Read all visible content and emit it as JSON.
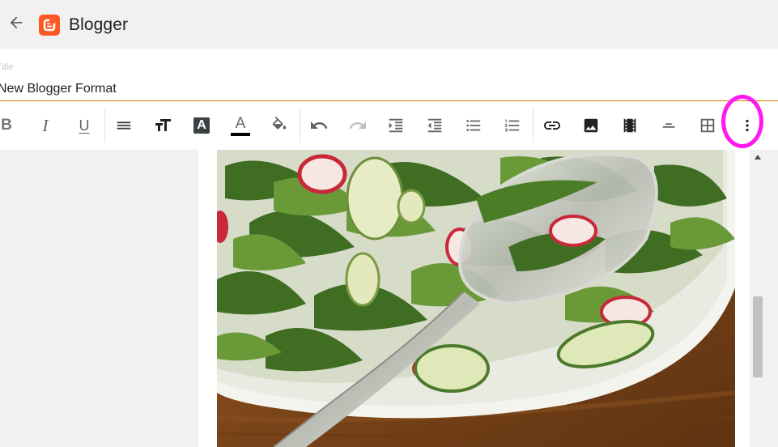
{
  "header": {
    "app_name": "Blogger",
    "back_icon": "arrow-back-icon",
    "logo_icon": "blogger-logo-icon",
    "logo_color": "#ff5722"
  },
  "post": {
    "title_label": "Title",
    "title_value": "New Blogger Format"
  },
  "toolbar": {
    "buttons": [
      {
        "name": "bold",
        "label": "B",
        "icon": "bold-icon"
      },
      {
        "name": "italic",
        "label": "I",
        "icon": "italic-icon"
      },
      {
        "name": "underline",
        "label": "U",
        "icon": "underline-icon"
      },
      {
        "name": "paragraph",
        "icon": "paragraph-format-icon"
      },
      {
        "name": "font-size",
        "label": "TT",
        "icon": "font-size-icon"
      },
      {
        "name": "text-background",
        "label": "A",
        "icon": "text-background-icon"
      },
      {
        "name": "text-color",
        "label": "A",
        "icon": "text-color-icon"
      },
      {
        "name": "fill-color",
        "icon": "paint-bucket-icon"
      },
      {
        "name": "undo",
        "icon": "undo-icon"
      },
      {
        "name": "redo",
        "icon": "redo-icon"
      },
      {
        "name": "indent",
        "icon": "indent-icon"
      },
      {
        "name": "outdent",
        "icon": "outdent-icon"
      },
      {
        "name": "bulleted-list",
        "icon": "bulleted-list-icon"
      },
      {
        "name": "numbered-list",
        "icon": "numbered-list-icon"
      },
      {
        "name": "link",
        "icon": "link-icon"
      },
      {
        "name": "image",
        "icon": "image-icon"
      },
      {
        "name": "video",
        "icon": "video-icon"
      },
      {
        "name": "align",
        "icon": "align-icon"
      },
      {
        "name": "table",
        "icon": "table-icon"
      },
      {
        "name": "more",
        "icon": "more-vert-icon"
      }
    ],
    "highlight_color": "#ff19f0"
  },
  "colors": {
    "accent_underline": "#e8710a",
    "text_color_bar": "#000000"
  },
  "content": {
    "image_subject": "salad with radishes and cucumbers on white plate with serving spoon"
  }
}
